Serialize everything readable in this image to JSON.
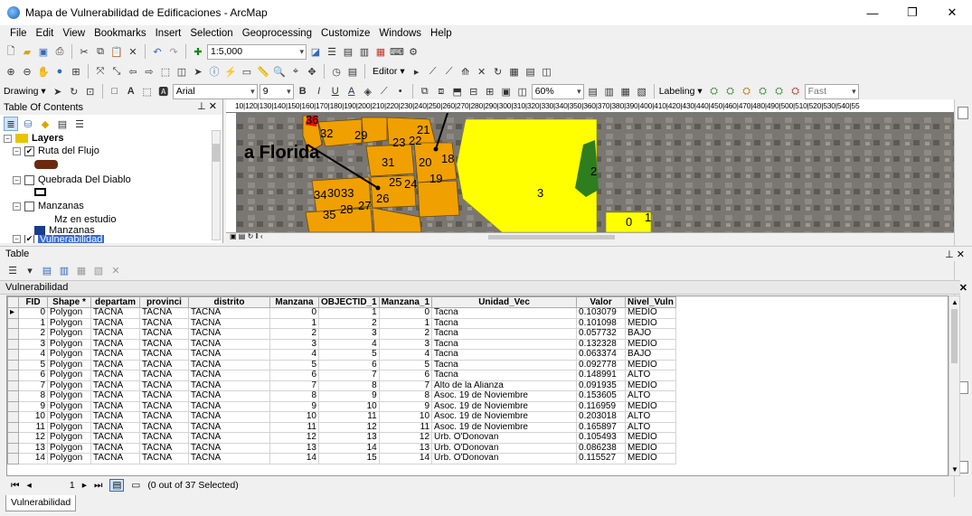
{
  "window": {
    "title": "Mapa de Vulnerabilidad de Edificaciones - ArcMap",
    "minimize": "—",
    "restore": "❐",
    "close": "✕"
  },
  "menu": [
    "File",
    "Edit",
    "View",
    "Bookmarks",
    "Insert",
    "Selection",
    "Geoprocessing",
    "Customize",
    "Windows",
    "Help"
  ],
  "toolbar1": {
    "scale": "1:5,000"
  },
  "toolbar2": {
    "editor": "Editor ▾"
  },
  "toolbar3": {
    "drawing": "Drawing ▾",
    "font": "Arial",
    "font_size": "9",
    "zoom": "60%",
    "labeling": "Labeling ▾",
    "fast": "Fast"
  },
  "toc": {
    "title": "Table Of Contents",
    "pin": "⊥ ✕",
    "layers_label": "Layers",
    "items": [
      {
        "label": "Ruta del Flujo",
        "checked": true
      },
      {
        "label": "Quebrada Del Diablo",
        "checked": false
      },
      {
        "label": "Manzanas",
        "checked": false
      },
      {
        "label": "Mz en estudio"
      },
      {
        "label": "Manzanas"
      },
      {
        "label": "Vulnerabilidad",
        "checked": true
      }
    ]
  },
  "map": {
    "ruler": "10|120|130|140|150|160|170|180|190|200|210|220|230|240|250|260|270|280|290|300|310|320|330|340|350|360|370|380|390|400|410|420|430|440|450|460|470|480|490|500|510|520|530|540|55",
    "place_label": "a Florida",
    "block_labels": [
      "36",
      "32",
      "29",
      "21",
      "23",
      "22",
      "31",
      "20",
      "18",
      "25",
      "24",
      "19",
      "34",
      "30",
      "33",
      "26",
      "27",
      "28",
      "35",
      "3",
      "2",
      "0",
      "1"
    ],
    "colors": {
      "orange": "#f0a000",
      "yellow": "#ffff00",
      "green": "#2e7d1e",
      "red": "#e01010"
    }
  },
  "table_panel": {
    "title": "Table",
    "pin": "⊥ ✕",
    "layer": "Vulnerabilidad",
    "close": "✕"
  },
  "table": {
    "columns": [
      "FID",
      "Shape *",
      "departam",
      "provinci",
      "distrito",
      "Manzana",
      "OBJECTID_1",
      "Manzana_1",
      "Unidad_Vec",
      "Valor",
      "Nivel_Vuln"
    ],
    "rows": [
      [
        "0",
        "Polygon",
        "TACNA",
        "TACNA",
        "TACNA",
        "0",
        "1",
        "0",
        "Tacna",
        "0.103079",
        "MEDIO"
      ],
      [
        "1",
        "Polygon",
        "TACNA",
        "TACNA",
        "TACNA",
        "1",
        "2",
        "1",
        "Tacna",
        "0.101098",
        "MEDIO"
      ],
      [
        "2",
        "Polygon",
        "TACNA",
        "TACNA",
        "TACNA",
        "2",
        "3",
        "2",
        "Tacna",
        "0.057732",
        "BAJO"
      ],
      [
        "3",
        "Polygon",
        "TACNA",
        "TACNA",
        "TACNA",
        "3",
        "4",
        "3",
        "Tacna",
        "0.132328",
        "MEDIO"
      ],
      [
        "4",
        "Polygon",
        "TACNA",
        "TACNA",
        "TACNA",
        "4",
        "5",
        "4",
        "Tacna",
        "0.063374",
        "BAJO"
      ],
      [
        "5",
        "Polygon",
        "TACNA",
        "TACNA",
        "TACNA",
        "5",
        "6",
        "5",
        "Tacna",
        "0.092778",
        "MEDIO"
      ],
      [
        "6",
        "Polygon",
        "TACNA",
        "TACNA",
        "TACNA",
        "6",
        "7",
        "6",
        "Tacna",
        "0.148991",
        "ALTO"
      ],
      [
        "7",
        "Polygon",
        "TACNA",
        "TACNA",
        "TACNA",
        "7",
        "8",
        "7",
        "Alto de la Alianza",
        "0.091935",
        "MEDIO"
      ],
      [
        "8",
        "Polygon",
        "TACNA",
        "TACNA",
        "TACNA",
        "8",
        "9",
        "8",
        "Asoc. 19 de Noviembre",
        "0.153605",
        "ALTO"
      ],
      [
        "9",
        "Polygon",
        "TACNA",
        "TACNA",
        "TACNA",
        "9",
        "10",
        "9",
        "Asoc. 19 de Noviembre",
        "0.116959",
        "MEDIO"
      ],
      [
        "10",
        "Polygon",
        "TACNA",
        "TACNA",
        "TACNA",
        "10",
        "11",
        "10",
        "Asoc. 19 de Noviembre",
        "0.203018",
        "ALTO"
      ],
      [
        "11",
        "Polygon",
        "TACNA",
        "TACNA",
        "TACNA",
        "11",
        "12",
        "11",
        "Asoc. 19 de Noviembre",
        "0.165897",
        "ALTO"
      ],
      [
        "12",
        "Polygon",
        "TACNA",
        "TACNA",
        "TACNA",
        "12",
        "13",
        "12",
        "Urb. O'Donovan",
        "0.105493",
        "MEDIO"
      ],
      [
        "13",
        "Polygon",
        "TACNA",
        "TACNA",
        "TACNA",
        "13",
        "14",
        "13",
        "Urb. O'Donovan",
        "0.086238",
        "MEDIO"
      ],
      [
        "14",
        "Polygon",
        "TACNA",
        "TACNA",
        "TACNA",
        "14",
        "15",
        "14",
        "Urb. O'Donovan",
        "0.115527",
        "MEDIO"
      ]
    ]
  },
  "nav": {
    "record": "1",
    "status": "(0 out of 37 Selected)"
  },
  "bottom_tab": "Vulnerabilidad"
}
